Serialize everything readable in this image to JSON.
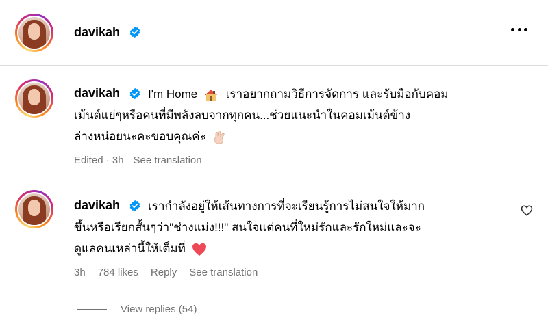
{
  "post": {
    "username": "davikah",
    "more_label": "More options"
  },
  "caption": {
    "username": "davikah",
    "text_line1": "I'm Home",
    "text_line1b": "เราอยากถามวิธีการจัดการ และรับมือกับคอม",
    "text_line2": "เม้นต์แย่ๆหรือคนที่มีพลังลบจากทุกคน...ช่วยแนะนำในคอมเม้นต์ข้าง",
    "text_line3": "ล่างหน่อยนะคะขอบคุณค่ะ",
    "edited": "Edited · 3h",
    "see_translation": "See translation",
    "icons": [
      "house-emoji",
      "hand-emoji"
    ]
  },
  "comment": {
    "username": "davikah",
    "text_line1": "เรากำลังอยู่ให้เส้นทางการที่จะเรียนรู้การไม่สนใจให้มาก",
    "text_line2": "ขึ้นหรือเรียกสั้นๆว่า\"ช่างแม่ง!!!\" สนใจแต่คนที่ใหม่รักและรักใหม่และจะ",
    "text_line3": "ดูแลคนเหล่านี้ให้เต็มที่",
    "time": "3h",
    "likes": "784 likes",
    "reply": "Reply",
    "see_translation": "See translation",
    "view_replies": "View replies (54)",
    "heart_color": "#ed4956"
  },
  "colors": {
    "verified": "#0095f6",
    "muted": "#737373",
    "divider": "#dbdbdb"
  }
}
